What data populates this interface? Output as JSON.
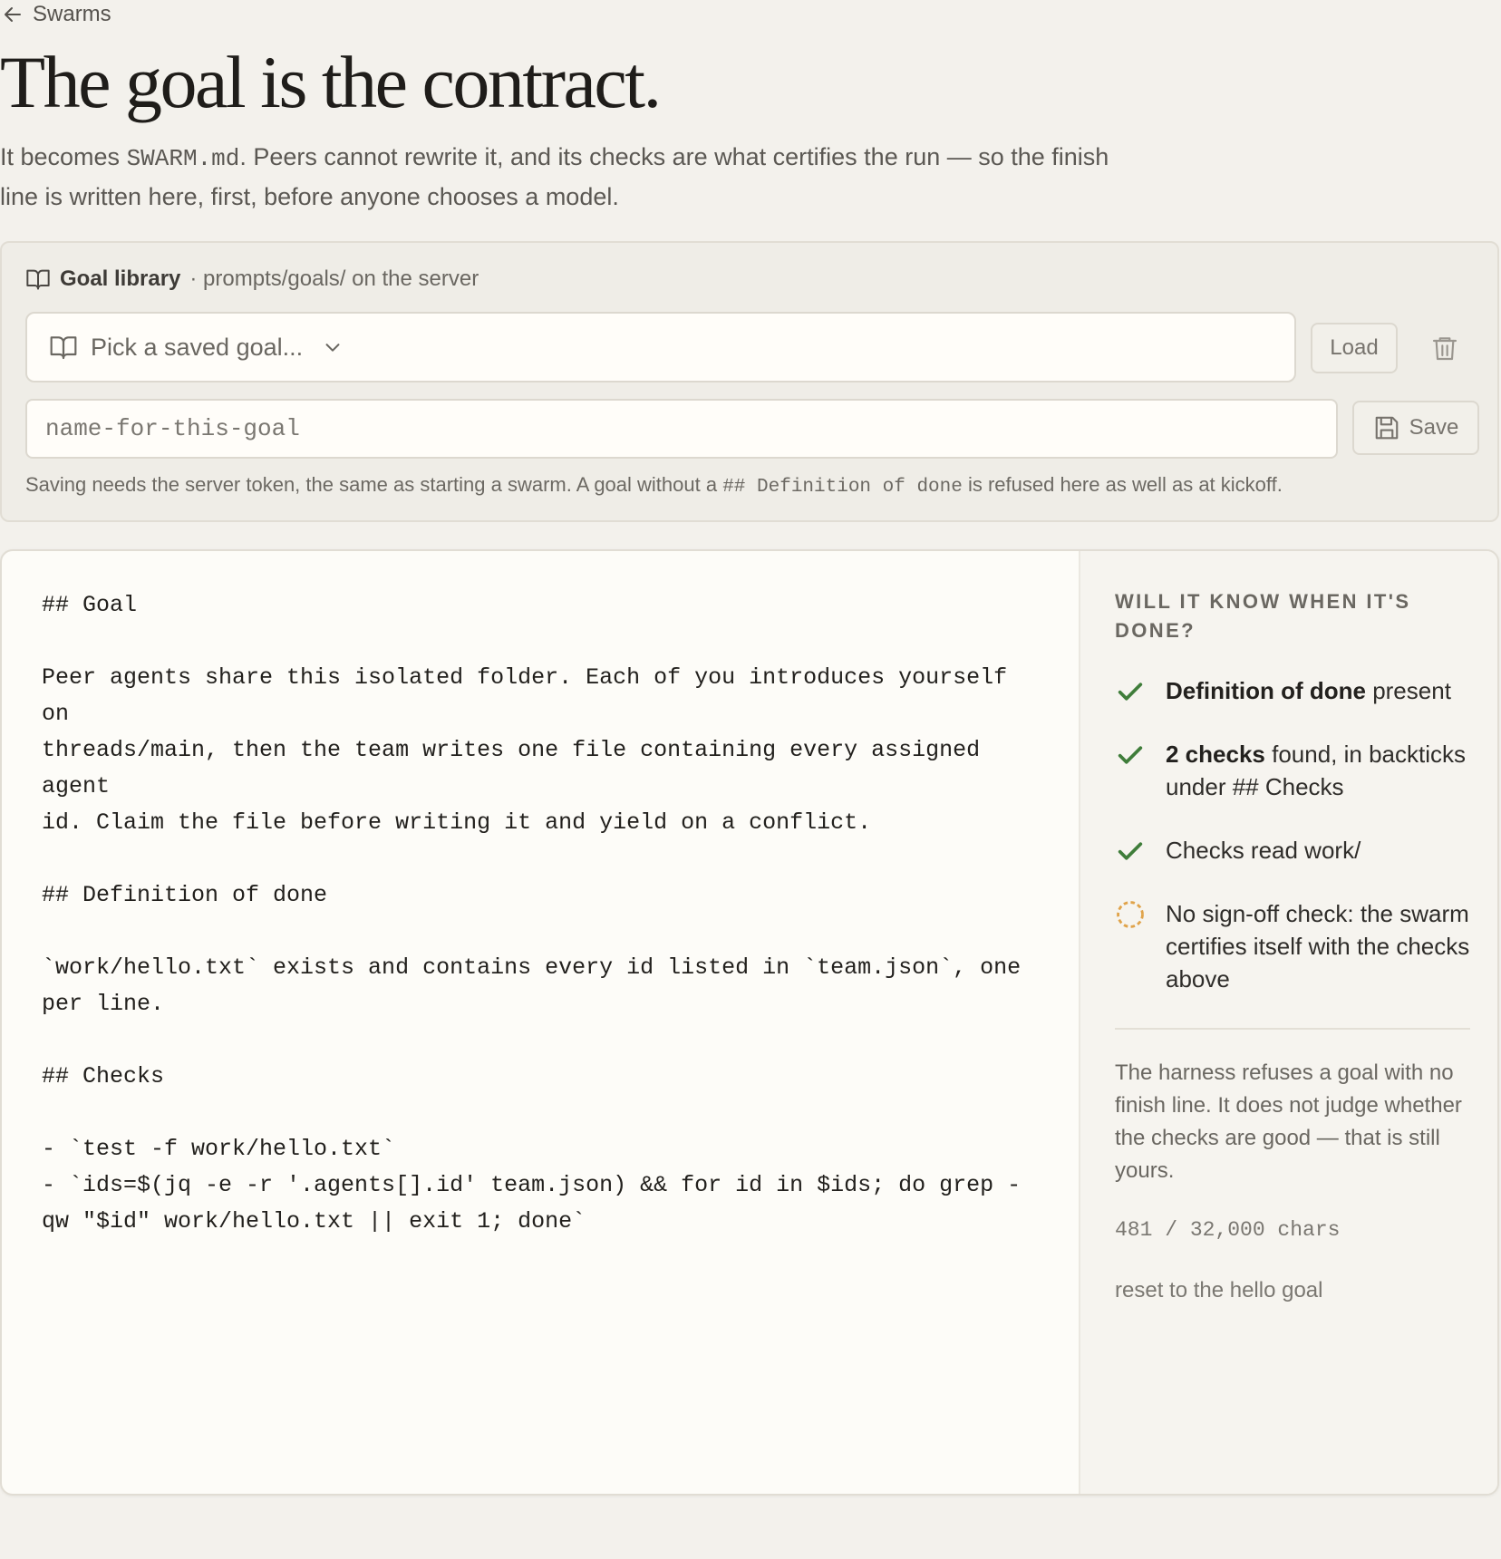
{
  "nav": {
    "back_label": "Swarms"
  },
  "title": "The goal is the contract.",
  "lede": {
    "part1": "It becomes ",
    "code": "SWARM.md",
    "part2": ". Peers cannot rewrite it, and its checks are what certifies the run — so the finish line is written here, first, before anyone chooses a model."
  },
  "library": {
    "title": "Goal library",
    "subtitle": "· prompts/goals/ on the server",
    "picker_placeholder": "Pick a saved goal...",
    "load_label": "Load",
    "name_placeholder": "name-for-this-goal",
    "save_label": "Save",
    "note_part1": "Saving needs the server token, the same as starting a swarm. A goal without a ",
    "note_code": "## Definition of done",
    "note_part2": " is refused here as well as at kickoff."
  },
  "editor": {
    "content": "## Goal\n\nPeer agents share this isolated folder. Each of you introduces yourself on\nthreads/main, then the team writes one file containing every assigned agent\nid. Claim the file before writing it and yield on a conflict.\n\n## Definition of done\n\n`work/hello.txt` exists and contains every id listed in `team.json`, one per line.\n\n## Checks\n\n- `test -f work/hello.txt`\n- `ids=$(jq -e -r '.agents[].id' team.json) && for id in $ids; do grep -qw \"$id\" work/hello.txt || exit 1; done`"
  },
  "sidebar": {
    "heading": "WILL IT KNOW WHEN IT'S DONE?",
    "checks": [
      {
        "status": "pass",
        "icon": "checkmark-icon",
        "bold": "Definition of done",
        "text": " present"
      },
      {
        "status": "pass",
        "icon": "checkmark-icon",
        "bold": "2 checks",
        "text": " found, in backticks under ## Checks"
      },
      {
        "status": "pass",
        "icon": "checkmark-icon",
        "bold": "",
        "text": "Checks read work/"
      },
      {
        "status": "warn",
        "icon": "dashed-circle-icon",
        "bold": "",
        "text": "No sign-off check: the swarm certifies itself with the checks above"
      }
    ],
    "note": "The harness refuses a goal with no finish line. It does not judge whether the checks are good — that is still yours.",
    "char_count": "481 / 32,000 chars",
    "reset_label": "reset to the hello goal"
  },
  "colors": {
    "background": "#f3f1ec",
    "check_green": "#3f7d3a",
    "warn_orange": "#e0a34a"
  }
}
